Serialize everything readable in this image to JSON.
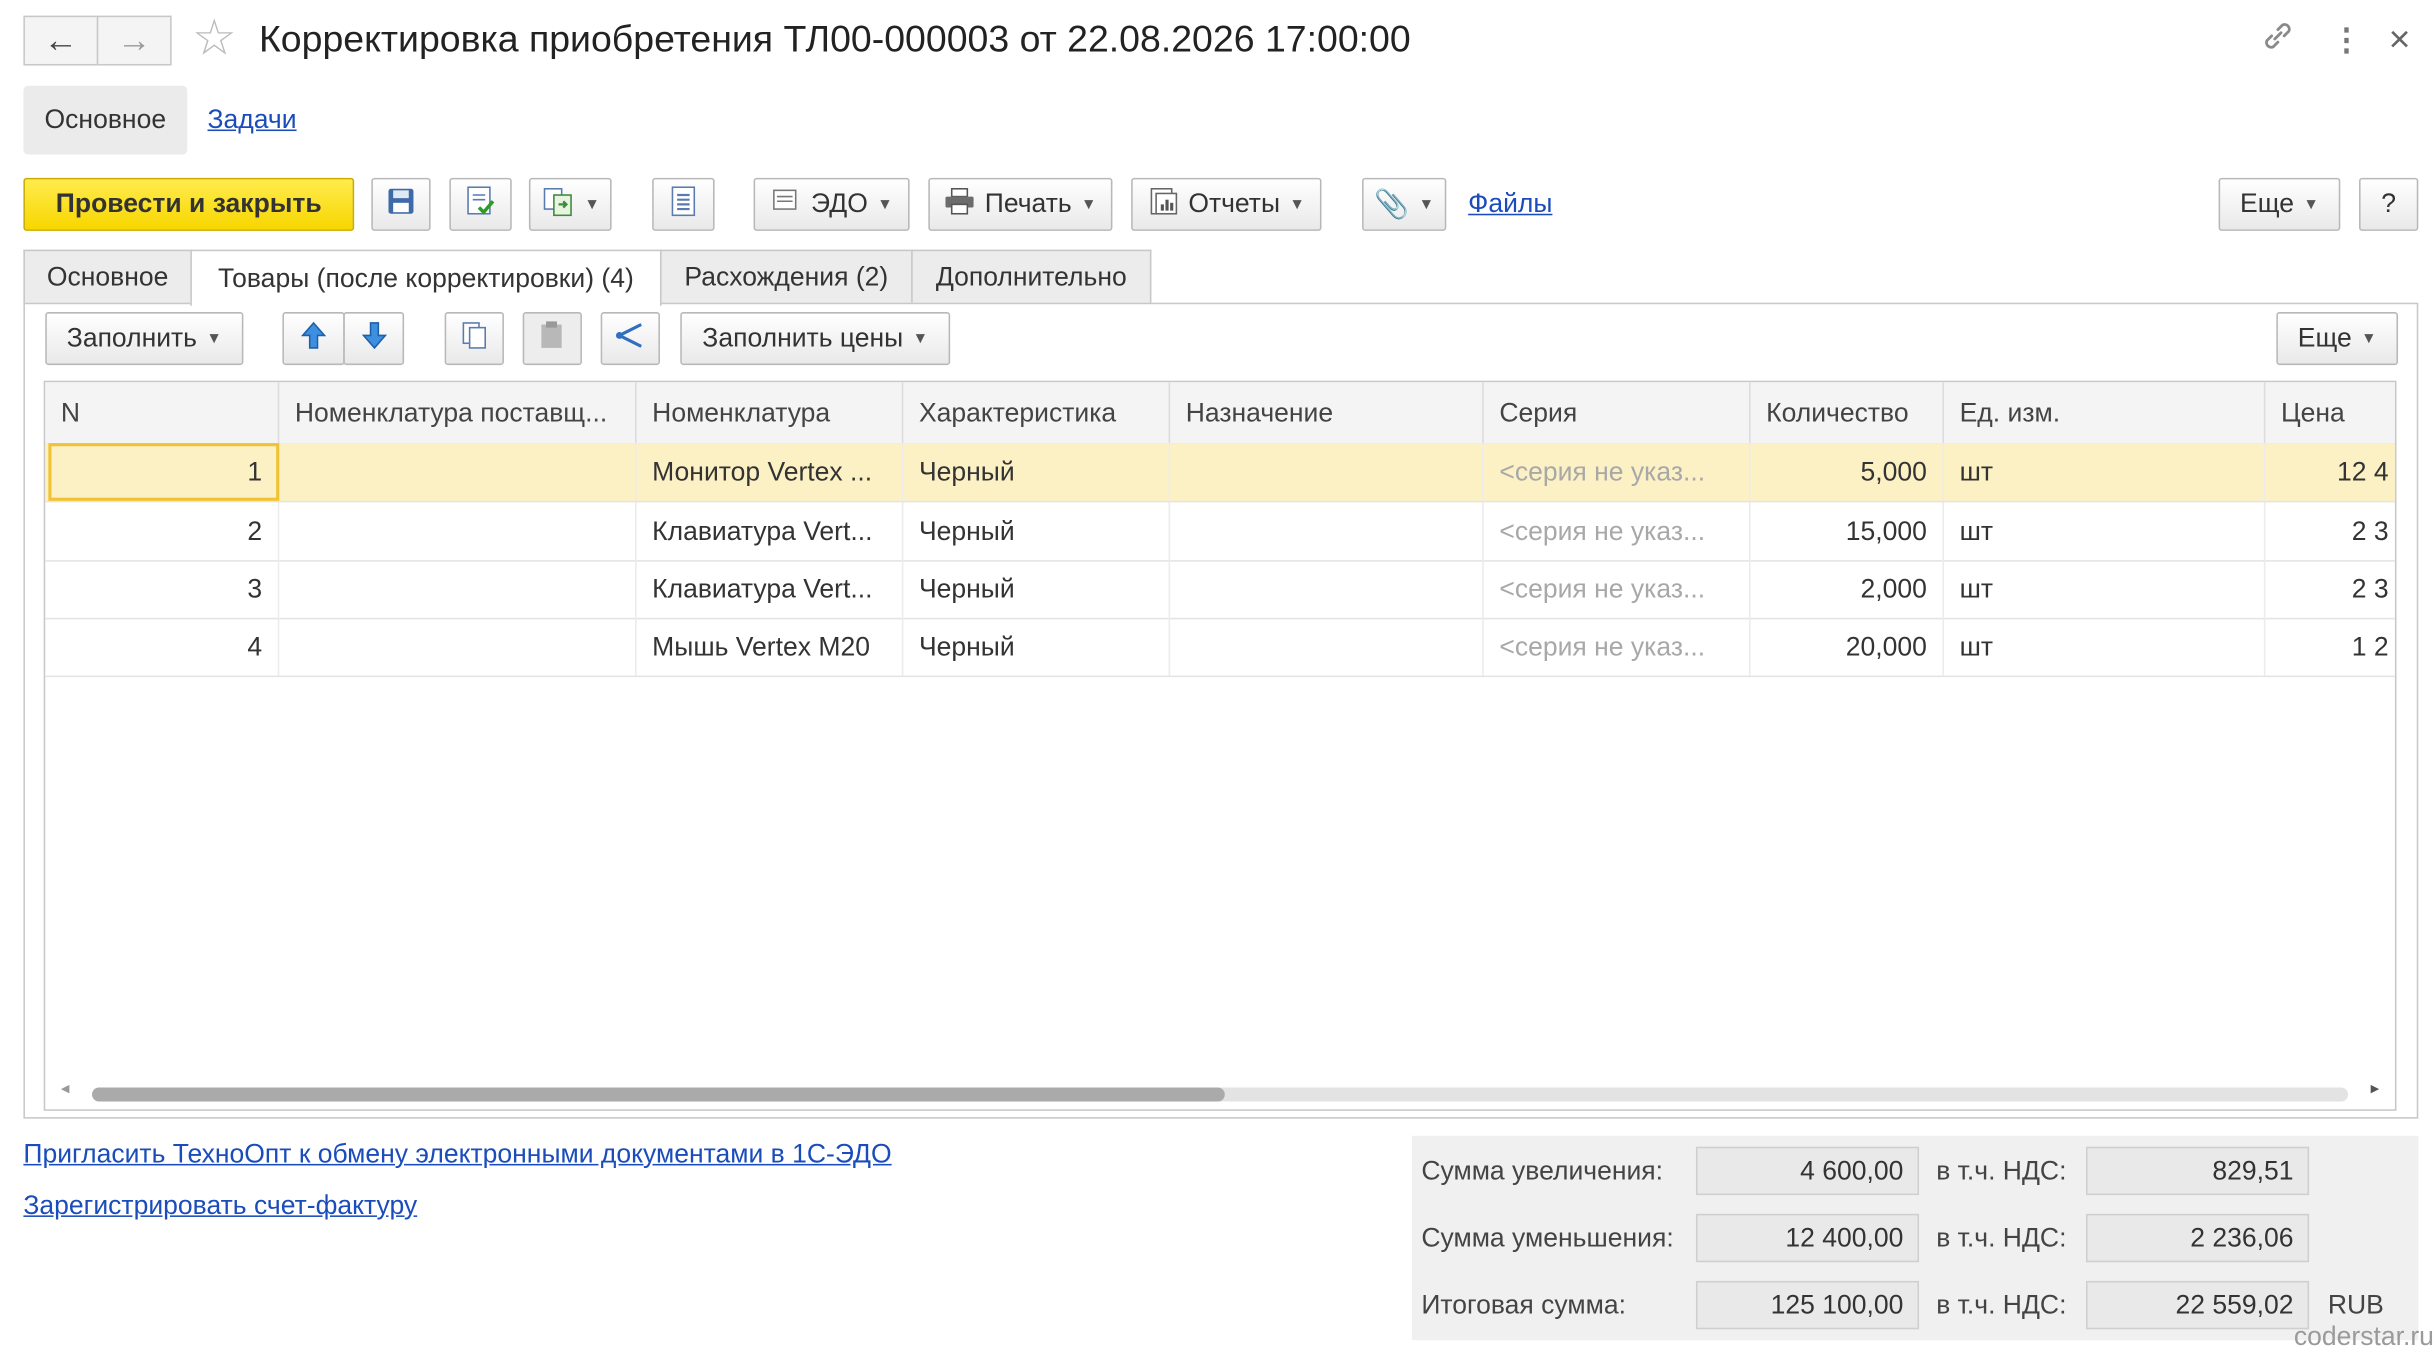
{
  "window": {
    "title": "Корректировка приобретения ТЛ00-000003 от 22.08.2026 17:00:00",
    "back_icon": "←",
    "forward_icon": "→",
    "star_icon": "☆",
    "link_icon": "🔗",
    "more_icon": "⋮",
    "close_icon": "×"
  },
  "sections": {
    "main": "Основное",
    "tasks": "Задачи"
  },
  "toolbar": {
    "post_close": "Провести и закрыть",
    "edo": "ЭДО",
    "print": "Печать",
    "reports": "Отчеты",
    "files": "Файлы",
    "more": "Еще",
    "help": "?"
  },
  "tabs": [
    "Основное",
    "Товары (после корректировки) (4)",
    "Расхождения (2)",
    "Дополнительно"
  ],
  "table_toolbar": {
    "fill": "Заполнить",
    "fill_prices": "Заполнить цены",
    "more": "Еще"
  },
  "table": {
    "columns": [
      "N",
      "Номенклатура поставщ...",
      "Номенклатура",
      "Характеристика",
      "Назначение",
      "Серия",
      "Количество",
      "Ед. изм.",
      "Цена"
    ],
    "rows": [
      {
        "n": "1",
        "supplier_item": "",
        "item": "Монитор Vertex ...",
        "characteristic": "Черный",
        "purpose": "",
        "series": "<серия не указ...",
        "quantity": "5,000",
        "unit": "шт",
        "price": "12 4"
      },
      {
        "n": "2",
        "supplier_item": "",
        "item": "Клавиатура Vert...",
        "characteristic": "Черный",
        "purpose": "",
        "series": "<серия не указ...",
        "quantity": "15,000",
        "unit": "шт",
        "price": "2 3"
      },
      {
        "n": "3",
        "supplier_item": "",
        "item": "Клавиатура Vert...",
        "characteristic": "Черный",
        "purpose": "",
        "series": "<серия не указ...",
        "quantity": "2,000",
        "unit": "шт",
        "price": "2 3"
      },
      {
        "n": "4",
        "supplier_item": "",
        "item": "Мышь Vertex M20",
        "characteristic": "Черный",
        "purpose": "",
        "series": "<серия не указ...",
        "quantity": "20,000",
        "unit": "шт",
        "price": "1 2"
      }
    ],
    "scroll_left": "◂",
    "scroll_right": "▸"
  },
  "links": {
    "invite": "Пригласить ТехноОпт к обмену электронными документами в 1С-ЭДО",
    "register": "Зарегистрировать счет-фактуру"
  },
  "totals": {
    "increase_label": "Сумма увеличения:",
    "increase_value": "4 600,00",
    "increase_vat_label": "в т.ч. НДС:",
    "increase_vat": "829,51",
    "decrease_label": "Сумма уменьшения:",
    "decrease_value": "12 400,00",
    "decrease_vat_label": "в т.ч. НДС:",
    "decrease_vat": "2 236,06",
    "total_label": "Итоговая сумма:",
    "total_value": "125 100,00",
    "total_vat_label": "в т.ч. НДС:",
    "total_vat": "22 559,02",
    "currency": "RUB"
  },
  "watermark": "coderstar.ru"
}
